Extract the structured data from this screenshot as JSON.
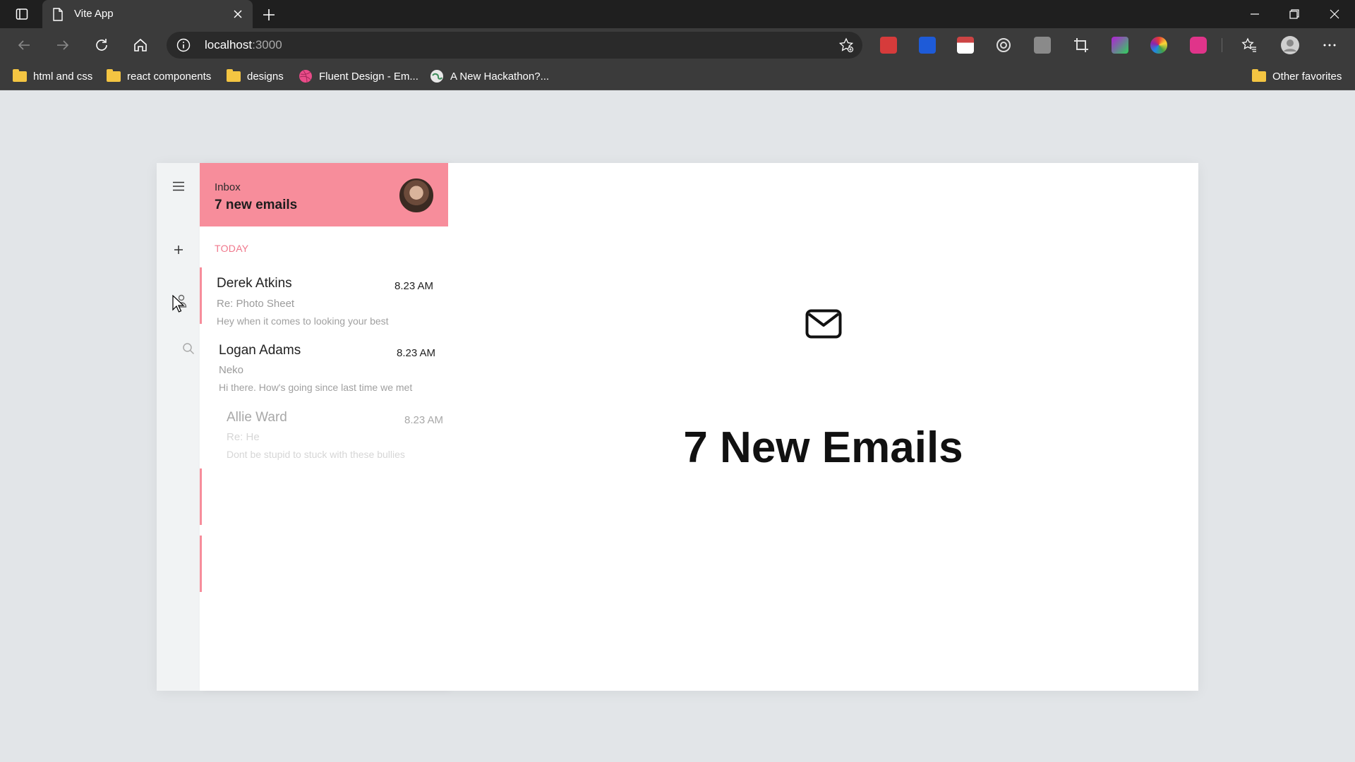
{
  "browser": {
    "tab_title": "Vite App",
    "url_host": "localhost",
    "url_port": ":3000",
    "bookmarks": [
      {
        "label": "html and css",
        "icon": "folder-icon"
      },
      {
        "label": "react components",
        "icon": "folder-icon"
      },
      {
        "label": "designs",
        "icon": "folder-icon"
      },
      {
        "label": "Fluent Design - Em...",
        "icon": "dribbble-icon"
      },
      {
        "label": "A New Hackathon?...",
        "icon": "globe-icon"
      }
    ],
    "other_favorites": "Other favorites"
  },
  "inbox": {
    "label": "Inbox",
    "count_text": "7 new emails",
    "section": "TODAY",
    "emails": [
      {
        "name": "Derek Atkins",
        "time": "8.23 AM",
        "subject": "Re: Photo Sheet",
        "preview": "Hey when it comes to looking your best"
      },
      {
        "name": "Logan Adams",
        "time": "8.23 AM",
        "subject": "Neko",
        "preview": "Hi there. How's going since last time we met"
      },
      {
        "name": "Allie Ward",
        "time": "8.23 AM",
        "subject": "Re: He",
        "preview": "Dont be stupid to stuck with these bullies"
      }
    ]
  },
  "main": {
    "headline": "7 New Emails",
    "icon": "mail-icon"
  },
  "colors": {
    "accent": "#f78d9b",
    "section_label": "#f0788c"
  }
}
